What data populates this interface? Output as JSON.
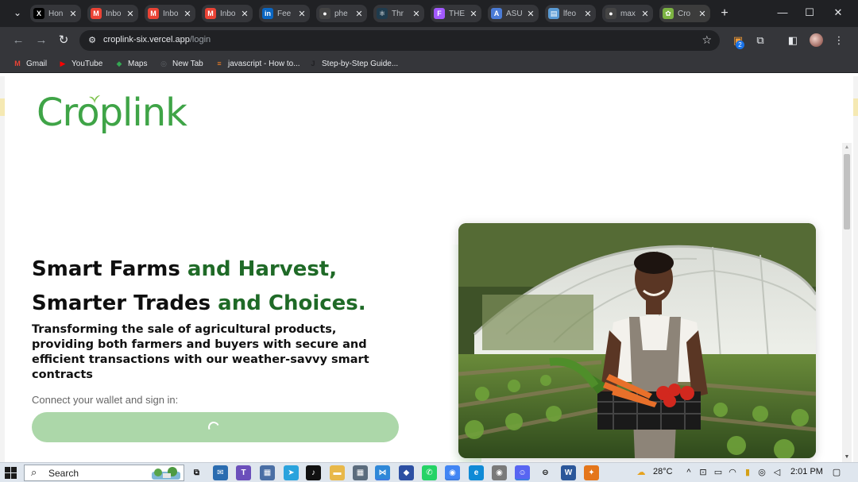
{
  "browser": {
    "tabs": [
      {
        "title": "Hon",
        "favicon": "x-icon",
        "color": "#000000",
        "glyph": "X"
      },
      {
        "title": "Inbo",
        "favicon": "gmail-icon",
        "color": "#ea4335",
        "glyph": "M"
      },
      {
        "title": "Inbo",
        "favicon": "gmail-icon",
        "color": "#ea4335",
        "glyph": "M"
      },
      {
        "title": "Inbo",
        "favicon": "gmail-icon",
        "color": "#ea4335",
        "glyph": "M"
      },
      {
        "title": "Fee",
        "favicon": "linkedin-icon",
        "color": "#0a66c2",
        "glyph": "in"
      },
      {
        "title": "phe",
        "favicon": "github-icon",
        "color": "#444444",
        "glyph": "●"
      },
      {
        "title": "Thr",
        "favicon": "react-icon",
        "color": "#1f3b4d",
        "glyph": "⚛"
      },
      {
        "title": "THE",
        "favicon": "figma-icon",
        "color": "#a259ff",
        "glyph": "F"
      },
      {
        "title": "ASU",
        "favicon": "asu-icon",
        "color": "#4a7bd6",
        "glyph": "A"
      },
      {
        "title": "lfeo",
        "favicon": "doc-icon",
        "color": "#5a9bd5",
        "glyph": "▤"
      },
      {
        "title": "max",
        "favicon": "github-icon",
        "color": "#444444",
        "glyph": "●"
      },
      {
        "title": "Cro",
        "favicon": "croplink-icon",
        "color": "#7cb342",
        "glyph": "✿",
        "active": true
      }
    ],
    "url_host": "croplink-six.vercel.app",
    "url_path": "/login",
    "extension_badge": "2",
    "bookmarks": [
      {
        "label": "Gmail",
        "icon": "gmail-icon",
        "color": "#ea4335",
        "glyph": "M"
      },
      {
        "label": "YouTube",
        "icon": "youtube-icon",
        "color": "#ff0000",
        "glyph": "▶"
      },
      {
        "label": "Maps",
        "icon": "maps-icon",
        "color": "#34a853",
        "glyph": "◆"
      },
      {
        "label": "New Tab",
        "icon": "globe-icon",
        "color": "#5f6368",
        "glyph": "◎"
      },
      {
        "label": "javascript - How to...",
        "icon": "stackoverflow-icon",
        "color": "#f48024",
        "glyph": "≡"
      },
      {
        "label": "Step-by-Step Guide...",
        "icon": "guide-icon",
        "color": "#202124",
        "glyph": "J"
      }
    ]
  },
  "page": {
    "logo_text": "Croplink",
    "headline_line1_a": "Smart Farms",
    "headline_line1_b": " and ",
    "headline_line1_c": "Harvest,",
    "headline_line2_a": "Smarter Trades",
    "headline_line2_b": " and ",
    "headline_line2_c": "Choices.",
    "subheading": "Transforming the sale of agricultural products, providing both farmers and buyers with secure and efficient transactions with our weather-savvy smart contracts",
    "connect_label": "Connect your wallet and sign in:",
    "colors": {
      "brand": "#3fa447",
      "accent": "#1f6a27",
      "button": "#acd7a9"
    }
  },
  "taskbar": {
    "search_label": "Search",
    "weather": "28°C",
    "time": "2:01 PM"
  }
}
